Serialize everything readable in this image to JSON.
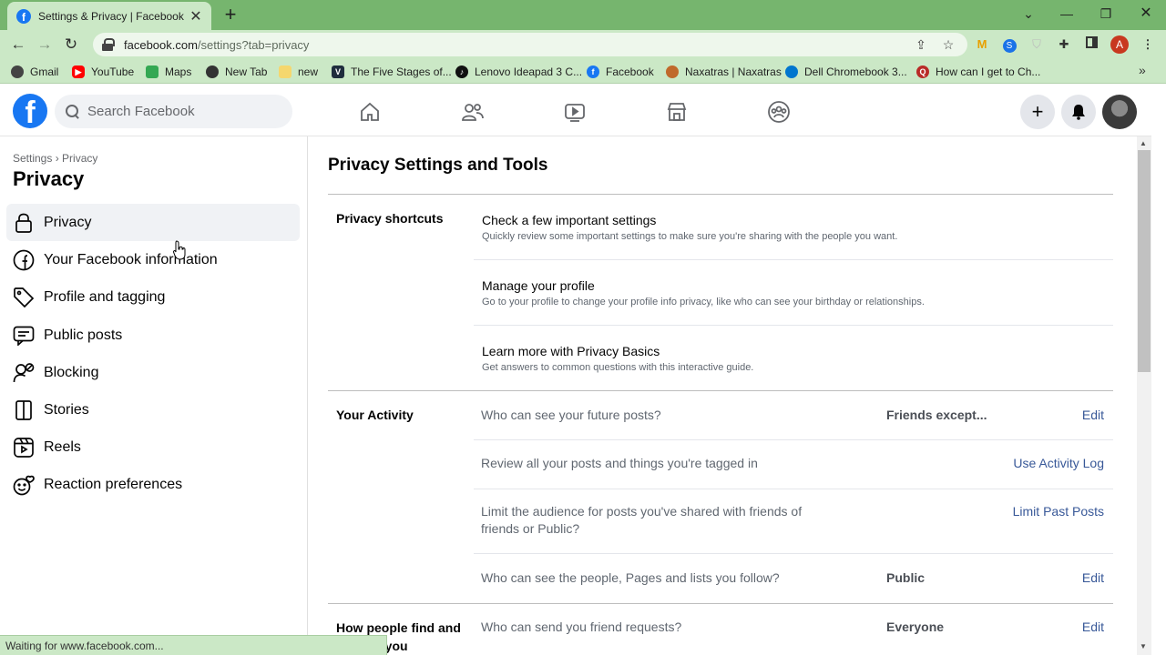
{
  "browser": {
    "tab_title": "Settings & Privacy | Facebook",
    "url_domain": "facebook.com",
    "url_path": "/settings?tab=privacy",
    "profile_initial": "A",
    "bookmarks": [
      {
        "label": "Gmail",
        "icon": "gmail-icon",
        "color": "#444444"
      },
      {
        "label": "YouTube",
        "icon": "youtube-icon",
        "color": "#ff0000"
      },
      {
        "label": "Maps",
        "icon": "maps-icon",
        "color": "#34a853"
      },
      {
        "label": "New Tab",
        "icon": "globe-icon",
        "color": "#333333"
      },
      {
        "label": "new",
        "icon": "folder-icon",
        "color": "#f5d76e"
      },
      {
        "label": "The Five Stages of...",
        "icon": "v-icon",
        "color": "#1f2d3d"
      },
      {
        "label": "Lenovo Ideapad 3 C...",
        "icon": "tiktok-icon",
        "color": "#111111"
      },
      {
        "label": "Facebook",
        "icon": "facebook-icon",
        "color": "#1877f2"
      },
      {
        "label": "Naxatras | Naxatras",
        "icon": "naxatras-icon",
        "color": "#c0692b"
      },
      {
        "label": "Dell Chromebook 3...",
        "icon": "dell-icon",
        "color": "#0076ce"
      },
      {
        "label": "How can I get to Ch...",
        "icon": "quora-icon",
        "color": "#b92b27"
      }
    ],
    "status_text": "Waiting for www.facebook.com..."
  },
  "facebook": {
    "search_placeholder": "Search Facebook"
  },
  "sidebar": {
    "breadcrumb": "Settings › Privacy",
    "title": "Privacy",
    "items": [
      {
        "label": "Privacy",
        "icon": "lock-icon"
      },
      {
        "label": "Your Facebook information",
        "icon": "facebook-circle-icon"
      },
      {
        "label": "Profile and tagging",
        "icon": "tag-icon"
      },
      {
        "label": "Public posts",
        "icon": "public-posts-icon"
      },
      {
        "label": "Blocking",
        "icon": "blocking-icon"
      },
      {
        "label": "Stories",
        "icon": "stories-icon"
      },
      {
        "label": "Reels",
        "icon": "reels-icon"
      },
      {
        "label": "Reaction preferences",
        "icon": "reaction-icon"
      }
    ]
  },
  "main": {
    "title": "Privacy Settings and Tools",
    "shortcuts": {
      "label": "Privacy shortcuts",
      "items": [
        {
          "title": "Check a few important settings",
          "desc": "Quickly review some important settings to make sure you're sharing with the people you want."
        },
        {
          "title": "Manage your profile",
          "desc": "Go to your profile to change your profile info privacy, like who can see your birthday or relationships."
        },
        {
          "title": "Learn more with Privacy Basics",
          "desc": "Get answers to common questions with this interactive guide."
        }
      ]
    },
    "activity": {
      "label": "Your Activity",
      "rows": [
        {
          "question": "Who can see your future posts?",
          "value": "Friends except...",
          "action": "Edit"
        },
        {
          "question": "Review all your posts and things you're tagged in",
          "value": "",
          "action": "Use Activity Log"
        },
        {
          "question": "Limit the audience for posts you've shared with friends of friends or Public?",
          "value": "",
          "action": "Limit Past Posts"
        },
        {
          "question": "Who can see the people, Pages and lists you follow?",
          "value": "Public",
          "action": "Edit"
        }
      ]
    },
    "find": {
      "label": "How people find and contact you",
      "rows": [
        {
          "question": "Who can send you friend requests?",
          "value": "Everyone",
          "action": "Edit"
        }
      ]
    }
  }
}
